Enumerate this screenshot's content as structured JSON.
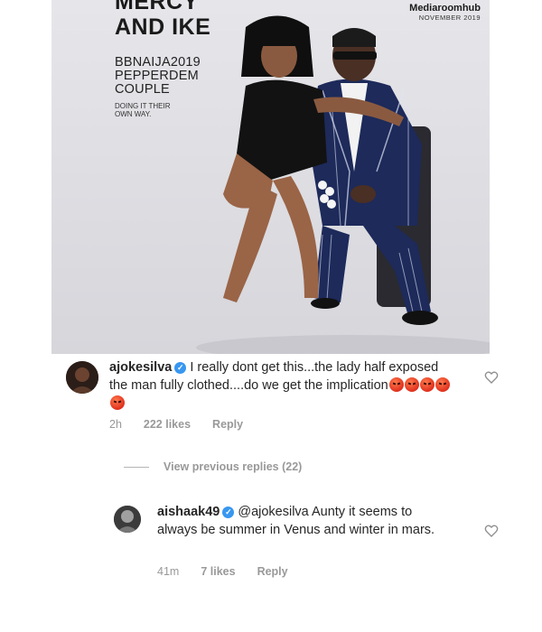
{
  "cover": {
    "title_line1": "MERCY",
    "title_line2": "AND IKE",
    "subtitle_line1": "BBNAIJA2019",
    "subtitle_line2": "PEPPERDEM",
    "subtitle_line3": "COUPLE",
    "tagline_line1": "DOING IT THEIR",
    "tagline_line2": "OWN WAY.",
    "brand": "Mediaroomhub",
    "date": "NOVEMBER 2019"
  },
  "comments": [
    {
      "username": "ajokesilva",
      "verified": true,
      "text": "I really dont get this...the lady half exposed the man fully clothed....do we get the implication",
      "emoji_count": 5,
      "time": "2h",
      "likes": "222 likes",
      "reply": "Reply"
    },
    {
      "username": "aishaak49",
      "verified": true,
      "mention": "@ajokesilva",
      "text": "Aunty it seems to always be summer in Venus and winter in mars.",
      "time": "41m",
      "likes": "7 likes",
      "reply": "Reply"
    }
  ],
  "view_previous": "View previous replies (22)",
  "icons": {
    "verified": "verified-badge-icon",
    "like": "heart-outline-icon",
    "emoji": "angry-face-emoji"
  },
  "colors": {
    "verified_blue": "#3897f0",
    "meta_gray": "#999999",
    "text": "#262626"
  }
}
